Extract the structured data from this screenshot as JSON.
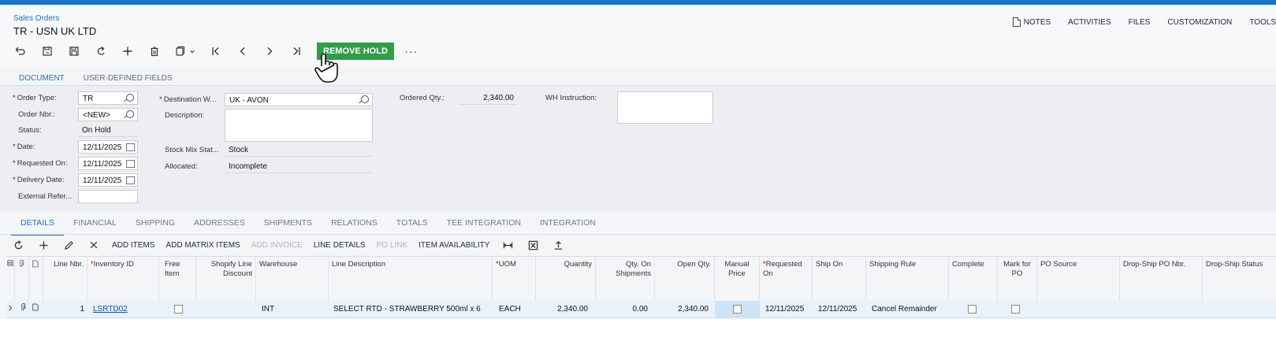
{
  "header": {
    "breadcrumb": "Sales Orders",
    "title": "TR - USN UK LTD",
    "actions": [
      "NOTES",
      "ACTIVITIES",
      "FILES",
      "CUSTOMIZATION",
      "TOOLS"
    ]
  },
  "toolbar": {
    "remove_hold_label": "REMOVE HOLD",
    "more_label": "···",
    "accent_color": "#2f9e44"
  },
  "tabs_top": [
    "DOCUMENT",
    "USER-DEFINED FIELDS"
  ],
  "form": {
    "order_type_label": "Order Type:",
    "order_type": "TR",
    "order_nbr_label": "Order Nbr.:",
    "order_nbr": "<NEW>",
    "status_label": "Status:",
    "status": "On Hold",
    "date_label": "Date:",
    "date": "12/11/2025",
    "requested_on_label": "Requested On:",
    "requested_on": "12/11/2025",
    "delivery_date_label": "Delivery Date:",
    "delivery_date": "12/11/2025",
    "external_ref_label": "External Refer...",
    "external_ref": "",
    "destination_label": "Destination W...",
    "destination": "UK - AVON",
    "description_label": "Description:",
    "description": "",
    "stock_mix_label": "Stock Mix Stat...",
    "stock_mix": "Stock",
    "allocated_label": "Allocated:",
    "allocated": "Incomplete",
    "ordered_qty_label": "Ordered Qty.:",
    "ordered_qty": "2,340.00",
    "wh_instruction_label": "WH Instruction:",
    "wh_instruction": ""
  },
  "tabs_bottom": [
    "DETAILS",
    "FINANCIAL",
    "SHIPPING",
    "ADDRESSES",
    "SHIPMENTS",
    "RELATIONS",
    "TOTALS",
    "TEE INTEGRATION",
    "INTEGRATION"
  ],
  "grid_toolbar": {
    "add_items": "ADD ITEMS",
    "add_matrix_items": "ADD MATRIX ITEMS",
    "add_invoice": "ADD INVOICE",
    "line_details": "LINE DETAILS",
    "po_link": "PO LINK",
    "item_availability": "ITEM AVAILABILITY"
  },
  "grid": {
    "columns": [
      "Line Nbr.",
      "Inventory ID",
      "Free Item",
      "Shopify Line Discount",
      "Warehouse",
      "Line Description",
      "UOM",
      "Quantity",
      "Qty. On Shipments",
      "Open Qty.",
      "Manual Price",
      "Requested On",
      "Ship On",
      "Shipping Rule",
      "Complete",
      "Mark for PO",
      "PO Source",
      "Drop-Ship PO Nbr.",
      "Drop-Ship Status"
    ],
    "rows": [
      {
        "line_nbr": "1",
        "inventory_id": "LSRTD02",
        "warehouse": "INT",
        "description": "SELECT RTD - STRAWBERRY 500ml x 6",
        "uom": "EACH",
        "quantity": "2,340.00",
        "qty_on_shipments": "0.00",
        "open_qty": "2,340.00",
        "requested_on": "12/11/2025",
        "ship_on": "12/11/2025",
        "shipping_rule": "Cancel Remainder"
      }
    ]
  }
}
